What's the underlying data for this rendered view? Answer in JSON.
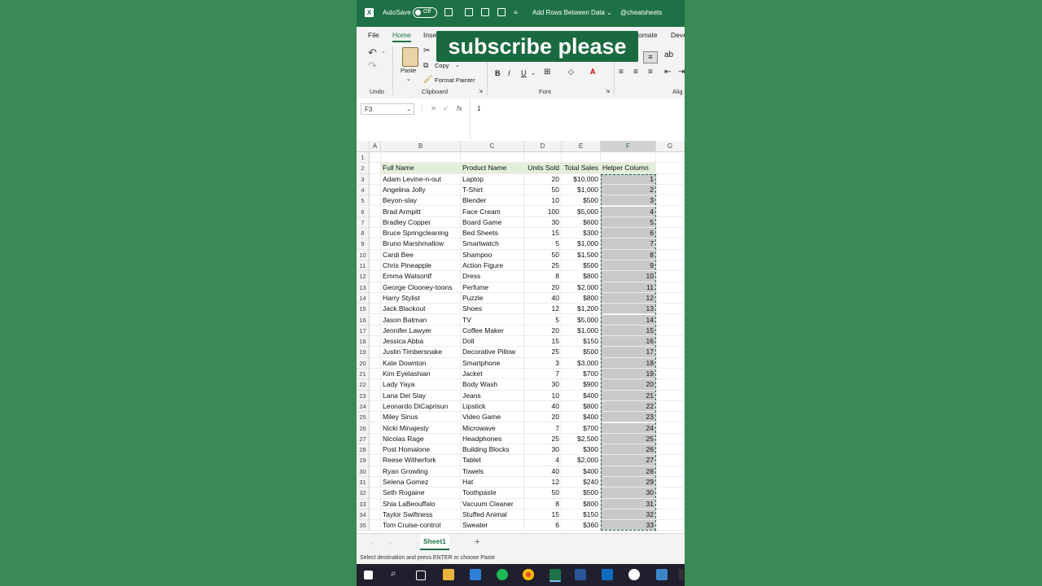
{
  "titlebar": {
    "autosave": "AutoSave",
    "toggle": "Off",
    "macro": "Add Rows Between Data",
    "handle": "@cheatsheets"
  },
  "menu": {
    "tabs": [
      "File",
      "Home",
      "Inse",
      "omate",
      "Deve"
    ]
  },
  "ribbon": {
    "paste": "Paste",
    "copy": "Copy",
    "format_painter": "Format Painter",
    "bold": "B",
    "italic": "I",
    "underline": "U",
    "groups": {
      "undo": "Undo",
      "clipboard": "Clipboard",
      "font": "Font",
      "alignment": "Alig"
    }
  },
  "banner": "subscribe please",
  "formula_bar": {
    "name_box": "F3",
    "fx": "fx",
    "value": "1"
  },
  "grid": {
    "columns": [
      "A",
      "B",
      "C",
      "D",
      "E",
      "F",
      "G"
    ],
    "selected_column": "F",
    "headers": [
      "Full Name",
      "Product Name",
      "Units Sold",
      "Total Sales",
      "Helper Column"
    ],
    "rows": [
      [
        "Adam Levine-n-out",
        "Laptop",
        "20",
        "$10,000",
        "1"
      ],
      [
        "Angelina Jolly",
        "T-Shirt",
        "50",
        "$1,000",
        "2"
      ],
      [
        "Beyon-slay",
        "Blender",
        "10",
        "$500",
        "3"
      ],
      [
        "Brad Armpitt",
        "Face Cream",
        "100",
        "$5,000",
        "4"
      ],
      [
        "Bradley Copper",
        "Board Game",
        "30",
        "$600",
        "5"
      ],
      [
        "Bruce Springcleaning",
        "Bed Sheets",
        "15",
        "$300",
        "6"
      ],
      [
        "Bruno Marshmallow",
        "Smartwatch",
        "5",
        "$1,000",
        "7"
      ],
      [
        "Cardi Bee",
        "Shampoo",
        "50",
        "$1,500",
        "8"
      ],
      [
        "Chris Pineapple",
        "Action Figure",
        "25",
        "$500",
        "9"
      ],
      [
        "Emma Watsontf",
        "Dress",
        "8",
        "$800",
        "10"
      ],
      [
        "George Clooney-toons",
        "Perfume",
        "20",
        "$2,000",
        "11"
      ],
      [
        "Harry Stylist",
        "Puzzle",
        "40",
        "$800",
        "12"
      ],
      [
        "Jack Blackout",
        "Shoes",
        "12",
        "$1,200",
        "13"
      ],
      [
        "Jason Batman",
        "TV",
        "5",
        "$5,000",
        "14"
      ],
      [
        "Jennifer Lawyer",
        "Coffee Maker",
        "20",
        "$1,000",
        "15"
      ],
      [
        "Jessica Abba",
        "Doll",
        "15",
        "$150",
        "16"
      ],
      [
        "Justin Timbersnake",
        "Decorative Pillow",
        "25",
        "$500",
        "17"
      ],
      [
        "Kate Downton",
        "Smartphone",
        "3",
        "$3,000",
        "18"
      ],
      [
        "Kim Eyelashian",
        "Jacket",
        "7",
        "$700",
        "19"
      ],
      [
        "Lady Yaya",
        "Body Wash",
        "30",
        "$900",
        "20"
      ],
      [
        "Lana Del Slay",
        "Jeans",
        "10",
        "$400",
        "21"
      ],
      [
        "Leonardo DiCaprisun",
        "Lipstick",
        "40",
        "$800",
        "22"
      ],
      [
        "Miley Sinus",
        "Video Game",
        "20",
        "$400",
        "23"
      ],
      [
        "Nicki Minajesty",
        "Microwave",
        "7",
        "$700",
        "24"
      ],
      [
        "Nicolas Rage",
        "Headphones",
        "25",
        "$2,500",
        "25"
      ],
      [
        "Post Homalone",
        "Building Blocks",
        "30",
        "$300",
        "26"
      ],
      [
        "Reese Witherfork",
        "Tablet",
        "4",
        "$2,000",
        "27"
      ],
      [
        "Ryan Growling",
        "Towels",
        "40",
        "$400",
        "28"
      ],
      [
        "Selena Gomez",
        "Hat",
        "12",
        "$240",
        "29"
      ],
      [
        "Seth Rogaine",
        "Toothpaste",
        "50",
        "$500",
        "30"
      ],
      [
        "Shia LaBeouffalo",
        "Vacuum Cleaner",
        "8",
        "$800",
        "31"
      ],
      [
        "Taylor Swiftness",
        "Stuffed Animal",
        "15",
        "$150",
        "32"
      ],
      [
        "Tom Cruise-control",
        "Sweater",
        "6",
        "$360",
        "33"
      ]
    ]
  },
  "sheet": {
    "tab": "Sheet1",
    "add": "+"
  },
  "status": "Select destination and press ENTER or choose Paste",
  "colors": {
    "excel_green": "#1e7145",
    "background": "#3a8a55",
    "header_fill": "#e2efda",
    "helper_fill": "#c9c9c9"
  },
  "icons": [
    "excel-icon",
    "save-icon",
    "undo-icon",
    "redo-icon",
    "paste-icon",
    "cut-icon",
    "copy-icon",
    "format-painter-icon",
    "windows-start-icon",
    "search-icon",
    "taskview-icon",
    "explorer-icon",
    "mail-icon",
    "spotify-icon",
    "chrome-icon",
    "excel-taskbar-icon",
    "word-icon",
    "outlook-icon"
  ]
}
